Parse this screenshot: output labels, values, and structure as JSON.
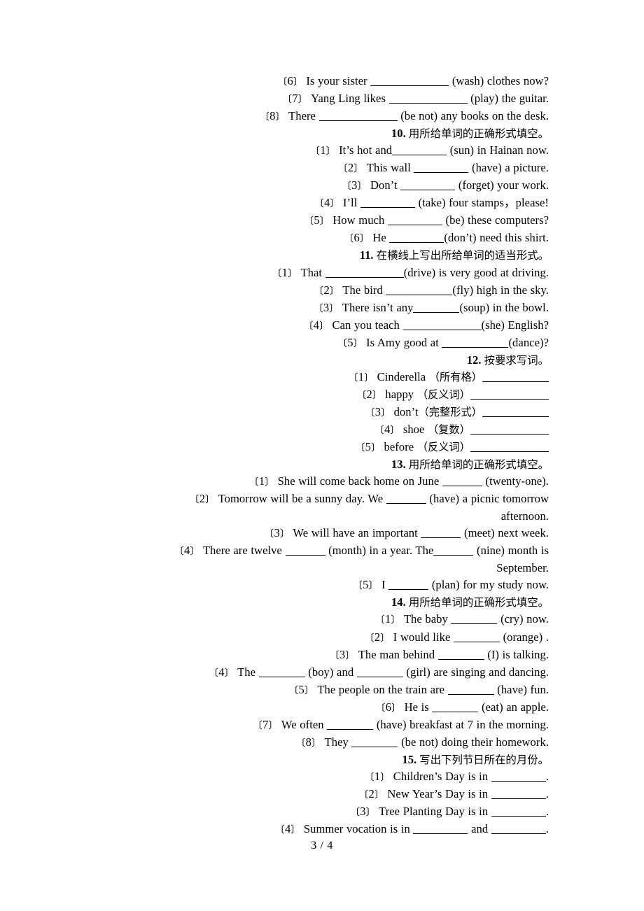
{
  "document": {
    "page_label": "3 / 4",
    "bracket_open": "〔",
    "bracket_close": "〕"
  },
  "carryover_items": [
    {
      "num": "6",
      "pre": "Is your sister",
      "blank": "xxl",
      "post": "(wash) clothes now?"
    },
    {
      "num": "7",
      "pre": "Yang Ling likes",
      "blank": "xxl",
      "post": "(play) the guitar."
    },
    {
      "num": "8",
      "pre": "There",
      "blank": "xxl",
      "post": "(be not) any books on the desk."
    }
  ],
  "sections": [
    {
      "number": "10.",
      "title_cn": "用所给单词的正确形式填空。",
      "items": [
        {
          "num": "1",
          "pre": "It’s hot and",
          "gap": false,
          "blank": "lg",
          "post": "(sun) in Hainan now."
        },
        {
          "num": "2",
          "pre": "This wall",
          "gap": true,
          "blank": "lg",
          "post": "(have) a picture."
        },
        {
          "num": "3",
          "pre": "Don’t",
          "gap": true,
          "blank": "lg",
          "post": "(forget) your work."
        },
        {
          "num": "4",
          "pre": "I’ll",
          "gap": true,
          "blank": "lg",
          "post": "(take) four stamps，please!"
        },
        {
          "num": "5",
          "pre": "How much",
          "gap": true,
          "blank": "lg",
          "post": "(be) these computers?"
        },
        {
          "num": "6",
          "pre": "He",
          "gap": true,
          "blank": "lg",
          "post": "(don’t) need this shirt."
        }
      ]
    },
    {
      "number": "11.",
      "title_cn": "在横线上写出所给单词的适当形式。",
      "items": [
        {
          "num": "1",
          "pre": "That",
          "gap": true,
          "blank": "xxl",
          "post": "(drive) is very good at driving."
        },
        {
          "num": "2",
          "pre": "The bird",
          "gap": true,
          "blank": "xl",
          "post": "(fly) high in the sky."
        },
        {
          "num": "3",
          "pre": "There isn’t any",
          "gap": false,
          "blank": "md",
          "post": "(soup) in the bowl."
        },
        {
          "num": "4",
          "pre": "Can you teach",
          "gap": true,
          "blank": "xxl",
          "post": "(she) English?"
        },
        {
          "num": "5",
          "pre": "Is Amy good at",
          "gap": true,
          "blank": "xl",
          "post": "(dance)?"
        }
      ]
    },
    {
      "number": "12.",
      "title_cn": "按要求写词。",
      "items": [
        {
          "num": "1",
          "word": "Cinderella",
          "cn": "（所有格）",
          "blank": "xl"
        },
        {
          "num": "2",
          "word": "happy",
          "cn": "（反义词）",
          "blank": "xxl"
        },
        {
          "num": "3",
          "word": "don’t",
          "cn": "（完整形式）",
          "blank": "xl"
        },
        {
          "num": "4",
          "word": "shoe",
          "cn": "（复数）",
          "blank": "xxl"
        },
        {
          "num": "5",
          "word": "before",
          "cn": "（反义词）",
          "blank": "xxl"
        }
      ]
    },
    {
      "number": "13.",
      "title_cn": "用所给单词的正确形式填空。",
      "items": [
        {
          "num": "1",
          "pre": "She will come back home on June",
          "gap": true,
          "blank": "sm",
          "post": "(twenty-one)."
        },
        {
          "num": "2",
          "pre": "Tomorrow will be a sunny day. We",
          "gap": true,
          "blank": "sm",
          "post": "(have) a picnic tomorrow",
          "cont": "afternoon."
        },
        {
          "num": "3",
          "pre": "We will have an important",
          "gap": true,
          "blank": "sm",
          "post": "(meet) next week."
        },
        {
          "num": "4",
          "pre": "There are twelve",
          "gap": true,
          "blank": "sm",
          "mid": "(month) in a year. The",
          "blank2": "sm",
          "post": "(nine) month is",
          "cont": "September."
        },
        {
          "num": "5",
          "pre": "I",
          "gap": true,
          "blank": "sm",
          "post": "(plan) for my study now."
        }
      ]
    },
    {
      "number": "14.",
      "title_cn": "用所给单词的正确形式填空。",
      "items": [
        {
          "num": "1",
          "pre": "The baby",
          "gap": true,
          "blank": "md",
          "post": "(cry) now."
        },
        {
          "num": "2",
          "pre": "I would like",
          "gap": true,
          "blank": "md",
          "post": "(orange) ."
        },
        {
          "num": "3",
          "pre": "The man behind",
          "gap": true,
          "blank": "md",
          "post": "(I) is talking."
        },
        {
          "num": "4",
          "pre": "The",
          "gap": true,
          "blank": "md",
          "mid": "(boy) and",
          "blank2": "md",
          "post": "(girl) are singing and dancing."
        },
        {
          "num": "5",
          "pre": "The people on the train are",
          "gap": true,
          "blank": "md",
          "post": "(have) fun."
        },
        {
          "num": "6",
          "pre": "He is",
          "gap": true,
          "blank": "md",
          "post": "(eat) an apple."
        },
        {
          "num": "7",
          "pre": "We often",
          "gap": true,
          "blank": "md",
          "post": "(have) breakfast at 7 in the morning."
        },
        {
          "num": "8",
          "pre": "They",
          "gap": true,
          "blank": "md",
          "post": "(be not) doing their homework."
        }
      ]
    },
    {
      "number": "15.",
      "title_cn": "写出下列节日所在的月份。",
      "items": [
        {
          "num": "1",
          "pre": "Children’s Day is in",
          "gap": true,
          "blank": "lg",
          "post": "."
        },
        {
          "num": "2",
          "pre": "New Year’s Day is in",
          "gap": true,
          "blank": "lg",
          "post": "."
        },
        {
          "num": "3",
          "pre": "Tree Planting Day is in",
          "gap": true,
          "blank": "lg",
          "post": "."
        },
        {
          "num": "4",
          "pre": "Summer vocation is in",
          "gap": true,
          "blank": "lg",
          "mid": "and",
          "blank2": "lg",
          "post": "."
        }
      ]
    }
  ]
}
